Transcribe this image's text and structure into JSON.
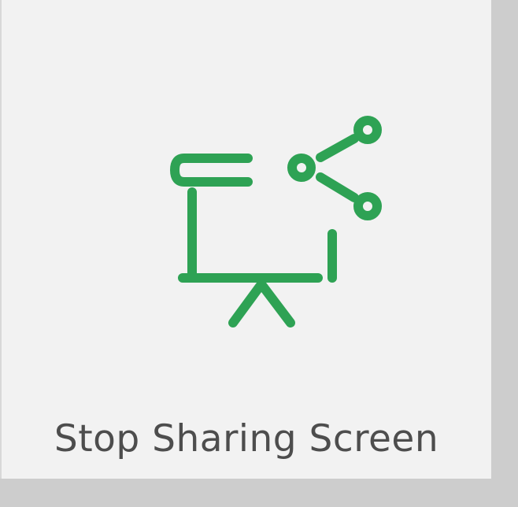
{
  "button": {
    "label": "Stop Sharing Screen",
    "icon": "stop-sharing-screen-icon",
    "icon_color": "#2ea254",
    "label_color": "#4d4d4d",
    "background_color": "#f2f2f2"
  }
}
